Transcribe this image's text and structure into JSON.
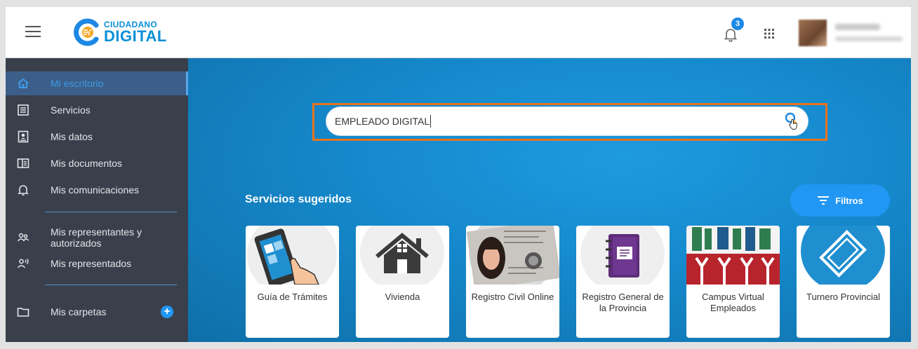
{
  "header": {
    "logo_top": "CIUDADANO",
    "logo_bottom": "DIGITAL",
    "notification_count": "3"
  },
  "sidebar": {
    "items": [
      {
        "label": "Mi escritorio",
        "icon": "home-icon"
      },
      {
        "label": "Servicios",
        "icon": "list-icon"
      },
      {
        "label": "Mis datos",
        "icon": "id-card-icon"
      },
      {
        "label": "Mis documentos",
        "icon": "documents-icon"
      },
      {
        "label": "Mis comunicaciones",
        "icon": "bell-icon"
      },
      {
        "label": "Mis representantes y autorizados",
        "icon": "people-icon"
      },
      {
        "label": "Mis representados",
        "icon": "speaking-person-icon"
      },
      {
        "label": "Mis carpetas",
        "icon": "folder-icon"
      }
    ],
    "add_folder": "+"
  },
  "search": {
    "value": "EMPLEADO DIGITAL"
  },
  "main": {
    "section_title": "Servicios sugeridos",
    "filter_label": "Filtros",
    "cards": [
      {
        "label": "Guía de Trámites"
      },
      {
        "label": "Vivienda"
      },
      {
        "label": "Registro Civil Online"
      },
      {
        "label": "Registro General de la Provincia"
      },
      {
        "label": "Campus Virtual Empleados"
      },
      {
        "label": "Turnero Provincial"
      }
    ]
  },
  "colors": {
    "accent": "#2196f3",
    "sidebar_bg": "#39404b",
    "highlight": "#e8731d",
    "main_bg": "#1588cb"
  }
}
